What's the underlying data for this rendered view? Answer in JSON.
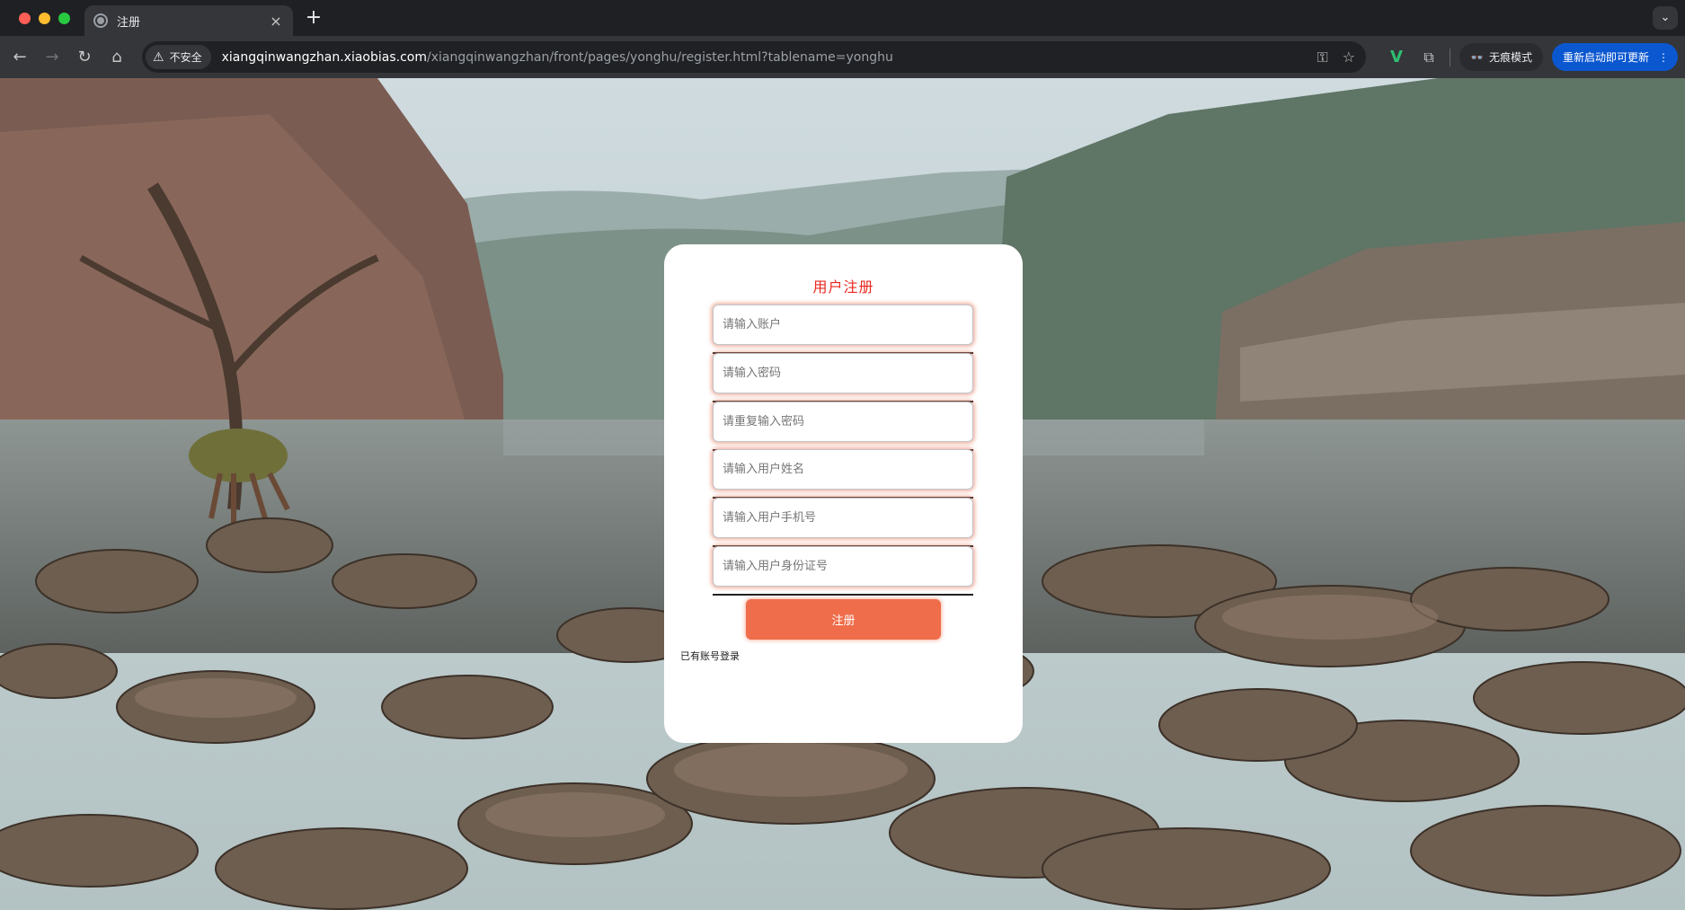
{
  "browser": {
    "tab_title": "注册",
    "tab_close": "×",
    "new_tab": "+",
    "tab_menu": "⌄",
    "security_label": "不安全",
    "url_host": "xiangqinwangzhan.xiaobias.com",
    "url_path": "/xiangqinwangzhan/front/pages/yonghu/register.html?tablename=yonghu",
    "incognito_label": "无痕模式",
    "update_label": "重新启动即可更新",
    "update_menu": "⋮",
    "ext_v": "V",
    "icons": {
      "back": "←",
      "forward": "→",
      "reload": "↻",
      "home": "⌂",
      "warning": "⚠",
      "key": "⚿",
      "star": "☆",
      "puzzle": "⧉",
      "incognito": "👓"
    }
  },
  "form": {
    "title": "用户注册",
    "fields": [
      {
        "name": "account",
        "placeholder": "请输入账户"
      },
      {
        "name": "password",
        "placeholder": "请输入密码"
      },
      {
        "name": "password-repeat",
        "placeholder": "请重复输入密码"
      },
      {
        "name": "user-name",
        "placeholder": "请输入用户姓名"
      },
      {
        "name": "phone",
        "placeholder": "请输入用户手机号"
      },
      {
        "name": "id-card",
        "placeholder": "请输入用户身份证号"
      }
    ],
    "submit_label": "注册",
    "login_link": "已有账号登录",
    "colors": {
      "title": "#e8271e",
      "button": "#ef6d4b"
    }
  }
}
